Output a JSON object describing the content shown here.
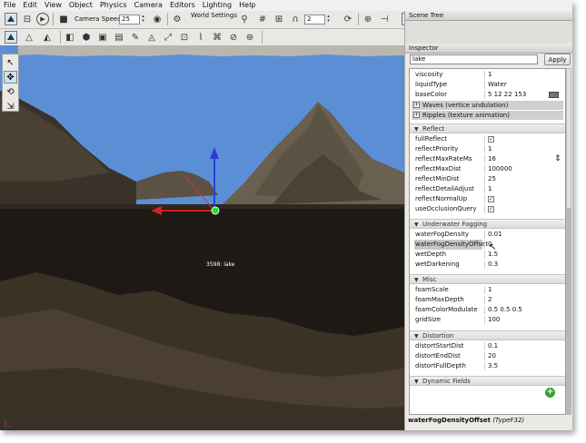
{
  "menu": [
    "File",
    "Edit",
    "View",
    "Object",
    "Physics",
    "Camera",
    "Editors",
    "Lighting",
    "Help"
  ],
  "toolbar": {
    "camera_speed_label": "Camera Speed",
    "camera_speed_value": "25",
    "world_settings_label": "World Settings",
    "snap_value": "2",
    "buttons": [
      "world-editor-icon",
      "play-icon",
      "camera-icon",
      "visibility-icon",
      "grid-icon",
      "magnet-icon",
      "select-icon",
      "text-icon"
    ]
  },
  "object_label": "3598: lake",
  "panel": {
    "scene_tree_title": "Scene Tree",
    "inspector_title": "Inspector",
    "search_value": "lake",
    "apply_label": "Apply",
    "top_rows": [
      {
        "name": "viscosity",
        "value": "1"
      },
      {
        "name": "liquidType",
        "value": "Water"
      },
      {
        "name": "baseColor",
        "value": "5 12 22 153"
      }
    ],
    "groups": [
      "Waves (vertice undulation)",
      "Ripples (texture animation)"
    ],
    "sections": [
      {
        "title": "Reflect",
        "rows": [
          {
            "name": "fullReflect",
            "value": "",
            "checkbox": true
          },
          {
            "name": "reflectPriority",
            "value": "1"
          },
          {
            "name": "reflectMaxRateMs",
            "value": "16"
          },
          {
            "name": "reflectMaxDist",
            "value": "100000"
          },
          {
            "name": "reflectMinDist",
            "value": "25"
          },
          {
            "name": "reflectDetailAdjust",
            "value": "1"
          },
          {
            "name": "reflectNormalUp",
            "value": "",
            "checkbox": true
          },
          {
            "name": "useOcclusionQuery",
            "value": "",
            "checkbox": true
          }
        ]
      },
      {
        "title": "Underwater Fogging",
        "rows": [
          {
            "name": "waterFogDensity",
            "value": "0.01"
          },
          {
            "name": "waterFogDensityOffset",
            "value": "0",
            "highlight": true
          },
          {
            "name": "wetDepth",
            "value": "1.5"
          },
          {
            "name": "wetDarkening",
            "value": "0.3"
          }
        ]
      },
      {
        "title": "Misc",
        "rows": [
          {
            "name": "foamScale",
            "value": "1"
          },
          {
            "name": "foamMaxDepth",
            "value": "2"
          },
          {
            "name": "foamColorModulate",
            "value": "0.5 0.5 0.5"
          },
          {
            "name": "gridSize",
            "value": "100"
          }
        ]
      },
      {
        "title": "Distortion",
        "rows": [
          {
            "name": "distortStartDist",
            "value": "0.1"
          },
          {
            "name": "distortEndDist",
            "value": "20"
          },
          {
            "name": "distortFullDepth",
            "value": "3.5"
          }
        ]
      },
      {
        "title": "Dynamic Fields",
        "rows": []
      }
    ],
    "status_name": "waterFogDensityOffset",
    "status_type": "(TypeF32)"
  },
  "colors": {
    "sky": "#5a8fd6",
    "terrain_dark": "#2c251d",
    "gizmo_up": "#2a3fd8",
    "gizmo_x": "#d62020",
    "gizmo_center": "#2fd82f"
  }
}
